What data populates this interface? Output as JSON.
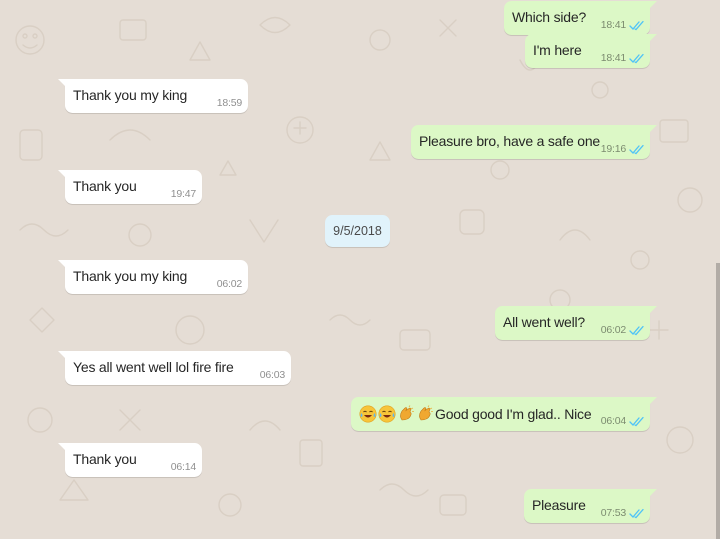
{
  "chat": {
    "date_separator": "9/5/2018",
    "messages": [
      {
        "text": "Which side?",
        "time": "18:41",
        "direction": "out",
        "status": "read"
      },
      {
        "text": "I'm here",
        "time": "18:41",
        "direction": "out",
        "status": "read"
      },
      {
        "text": "Thank you my king",
        "time": "18:59",
        "direction": "in"
      },
      {
        "text": "Pleasure bro, have a safe one",
        "time": "19:16",
        "direction": "out",
        "status": "read"
      },
      {
        "text": "Thank you",
        "time": "19:47",
        "direction": "in"
      },
      {
        "text": "Thank you my king",
        "time": "06:02",
        "direction": "in"
      },
      {
        "text": "All went well?",
        "time": "06:02",
        "direction": "out",
        "status": "read"
      },
      {
        "text": "Yes all went well lol fire fire",
        "time": "06:03",
        "direction": "in"
      },
      {
        "text": "Good good I'm glad.. Nice",
        "emojis": [
          "face-with-tears-of-joy",
          "face-with-tears-of-joy",
          "clapping-hands",
          "clapping-hands"
        ],
        "time": "06:04",
        "direction": "out",
        "status": "read"
      },
      {
        "text": "Thank you",
        "time": "06:14",
        "direction": "in"
      },
      {
        "text": "Pleasure",
        "time": "07:53",
        "direction": "out",
        "status": "read"
      }
    ]
  },
  "colors": {
    "background": "#e5ddd5",
    "incoming_bubble": "#ffffff",
    "outgoing_bubble": "#dcf8c6",
    "date_pill": "#e1f3fb",
    "read_ticks": "#4fc3f7"
  }
}
